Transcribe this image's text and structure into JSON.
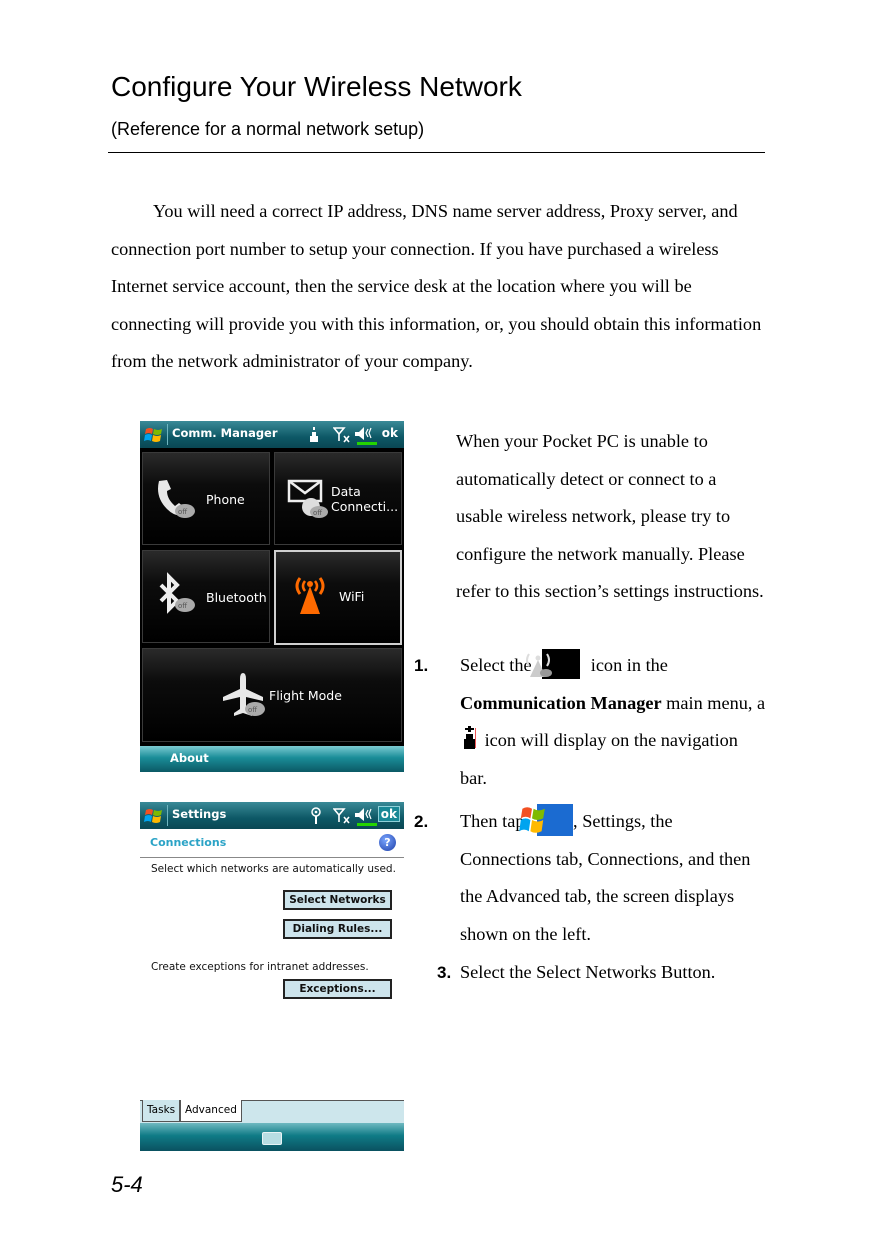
{
  "heading": {
    "title": "Configure Your Wireless Network",
    "subtitle": "(Reference for a normal network setup)"
  },
  "intro": "You will need a correct IP address, DNS name server address, Proxy server, and connection port number to setup your connection. If you have purchased a wireless Internet service account, then the service desk at the location where you will be connecting will provide you with this information, or, you should obtain this information from the network administrator of your company.",
  "side_paragraph": "When your Pocket PC is unable to automatically detect or connect to a usable wireless network, please try to configure the network manually. Please refer to this section’s settings instructions.",
  "steps": [
    {
      "number": "1.",
      "part1": "Select the",
      "icon1": "wifi-off-icon",
      "part2": "icon in the",
      "bold": "Communication Manager",
      "part3": "main menu, a",
      "icon2": "wireless-status-icon",
      "part4": "icon will display on the navigation bar."
    },
    {
      "number": "2.",
      "part1": "Then tap",
      "icon1": "windows-start-icon",
      "part2": ", Settings, the Connections tab, Connections, and then the Advanced tab, the screen displays shown on the left."
    },
    {
      "number": "3.",
      "text": "Select the Select Networks Button."
    }
  ],
  "screen1": {
    "title": "Comm. Manager",
    "ok": "ok",
    "tiles": [
      {
        "label": "Phone",
        "icon": "phone-off-icon"
      },
      {
        "label": "Data\nConnecti...",
        "label1": "Data",
        "label2": "Connecti...",
        "icon": "data-connection-off-icon"
      },
      {
        "label": "Bluetooth",
        "icon": "bluetooth-off-icon"
      },
      {
        "label": "WiFi",
        "icon": "wifi-on-icon",
        "selected": true
      },
      {
        "label": "Flight Mode",
        "icon": "flight-mode-off-icon"
      }
    ],
    "softkey": "About"
  },
  "screen2": {
    "title": "Settings",
    "ok": "ok",
    "section": "Connections",
    "text1": "Select which networks are automatically used.",
    "buttons": [
      "Select Networks",
      "Dialing Rules...",
      "Exceptions..."
    ],
    "text2": "Create exceptions for intranet addresses.",
    "tabs": [
      "Tasks",
      "Advanced"
    ],
    "active_tab": "Advanced"
  },
  "page_number": "5-4",
  "colors": {
    "titlebar": "#0d5866",
    "section_text": "#2ba3c6",
    "button_bg": "#cde4ec",
    "wifi_orange": "#ff6a00"
  }
}
